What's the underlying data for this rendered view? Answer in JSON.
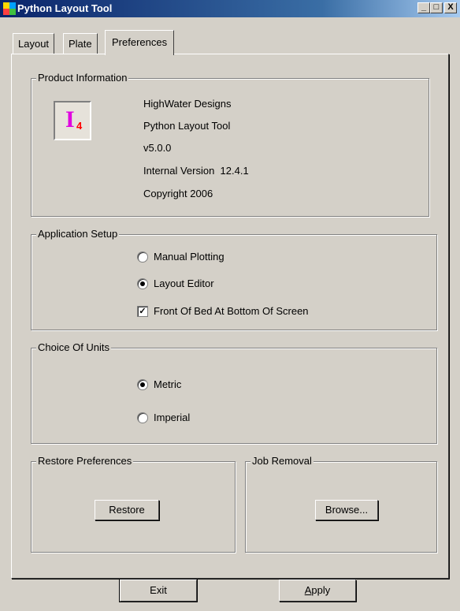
{
  "window": {
    "title": "Python Layout Tool"
  },
  "titlebar_buttons": {
    "minimize": "_",
    "maximize": "□",
    "close": "X"
  },
  "tabs": [
    {
      "label": "Layout",
      "active": false
    },
    {
      "label": "Plate",
      "active": false
    },
    {
      "label": "Preferences",
      "active": true
    }
  ],
  "product_info": {
    "legend": "Product Information",
    "logo_letter": "I",
    "logo_subscript": "4",
    "company": "HighWater Designs",
    "product": "Python Layout Tool",
    "version": "v5.0.0",
    "internal_version": "Internal Version  12.4.1",
    "copyright": "Copyright 2006"
  },
  "app_setup": {
    "legend": "Application Setup",
    "options": [
      {
        "label": "Manual Plotting",
        "selected": false
      },
      {
        "label": "Layout Editor",
        "selected": true
      }
    ],
    "front_of_bed": {
      "label": "Front Of Bed At Bottom Of Screen",
      "checked": true
    }
  },
  "units": {
    "legend": "Choice Of Units",
    "options": [
      {
        "label": "Metric",
        "selected": true
      },
      {
        "label": "Imperial",
        "selected": false
      }
    ]
  },
  "restore": {
    "legend": "Restore Preferences",
    "button": "Restore"
  },
  "job_removal": {
    "legend": "Job Removal",
    "button": "Browse..."
  },
  "footer": {
    "exit": "Exit",
    "apply": "Apply",
    "apply_mnemonic": "A"
  },
  "colors": {
    "titlebar_start": "#0a246a",
    "titlebar_end": "#a6caf0",
    "logo_letter": "#e000e0",
    "logo_subscript": "#ff0000"
  }
}
